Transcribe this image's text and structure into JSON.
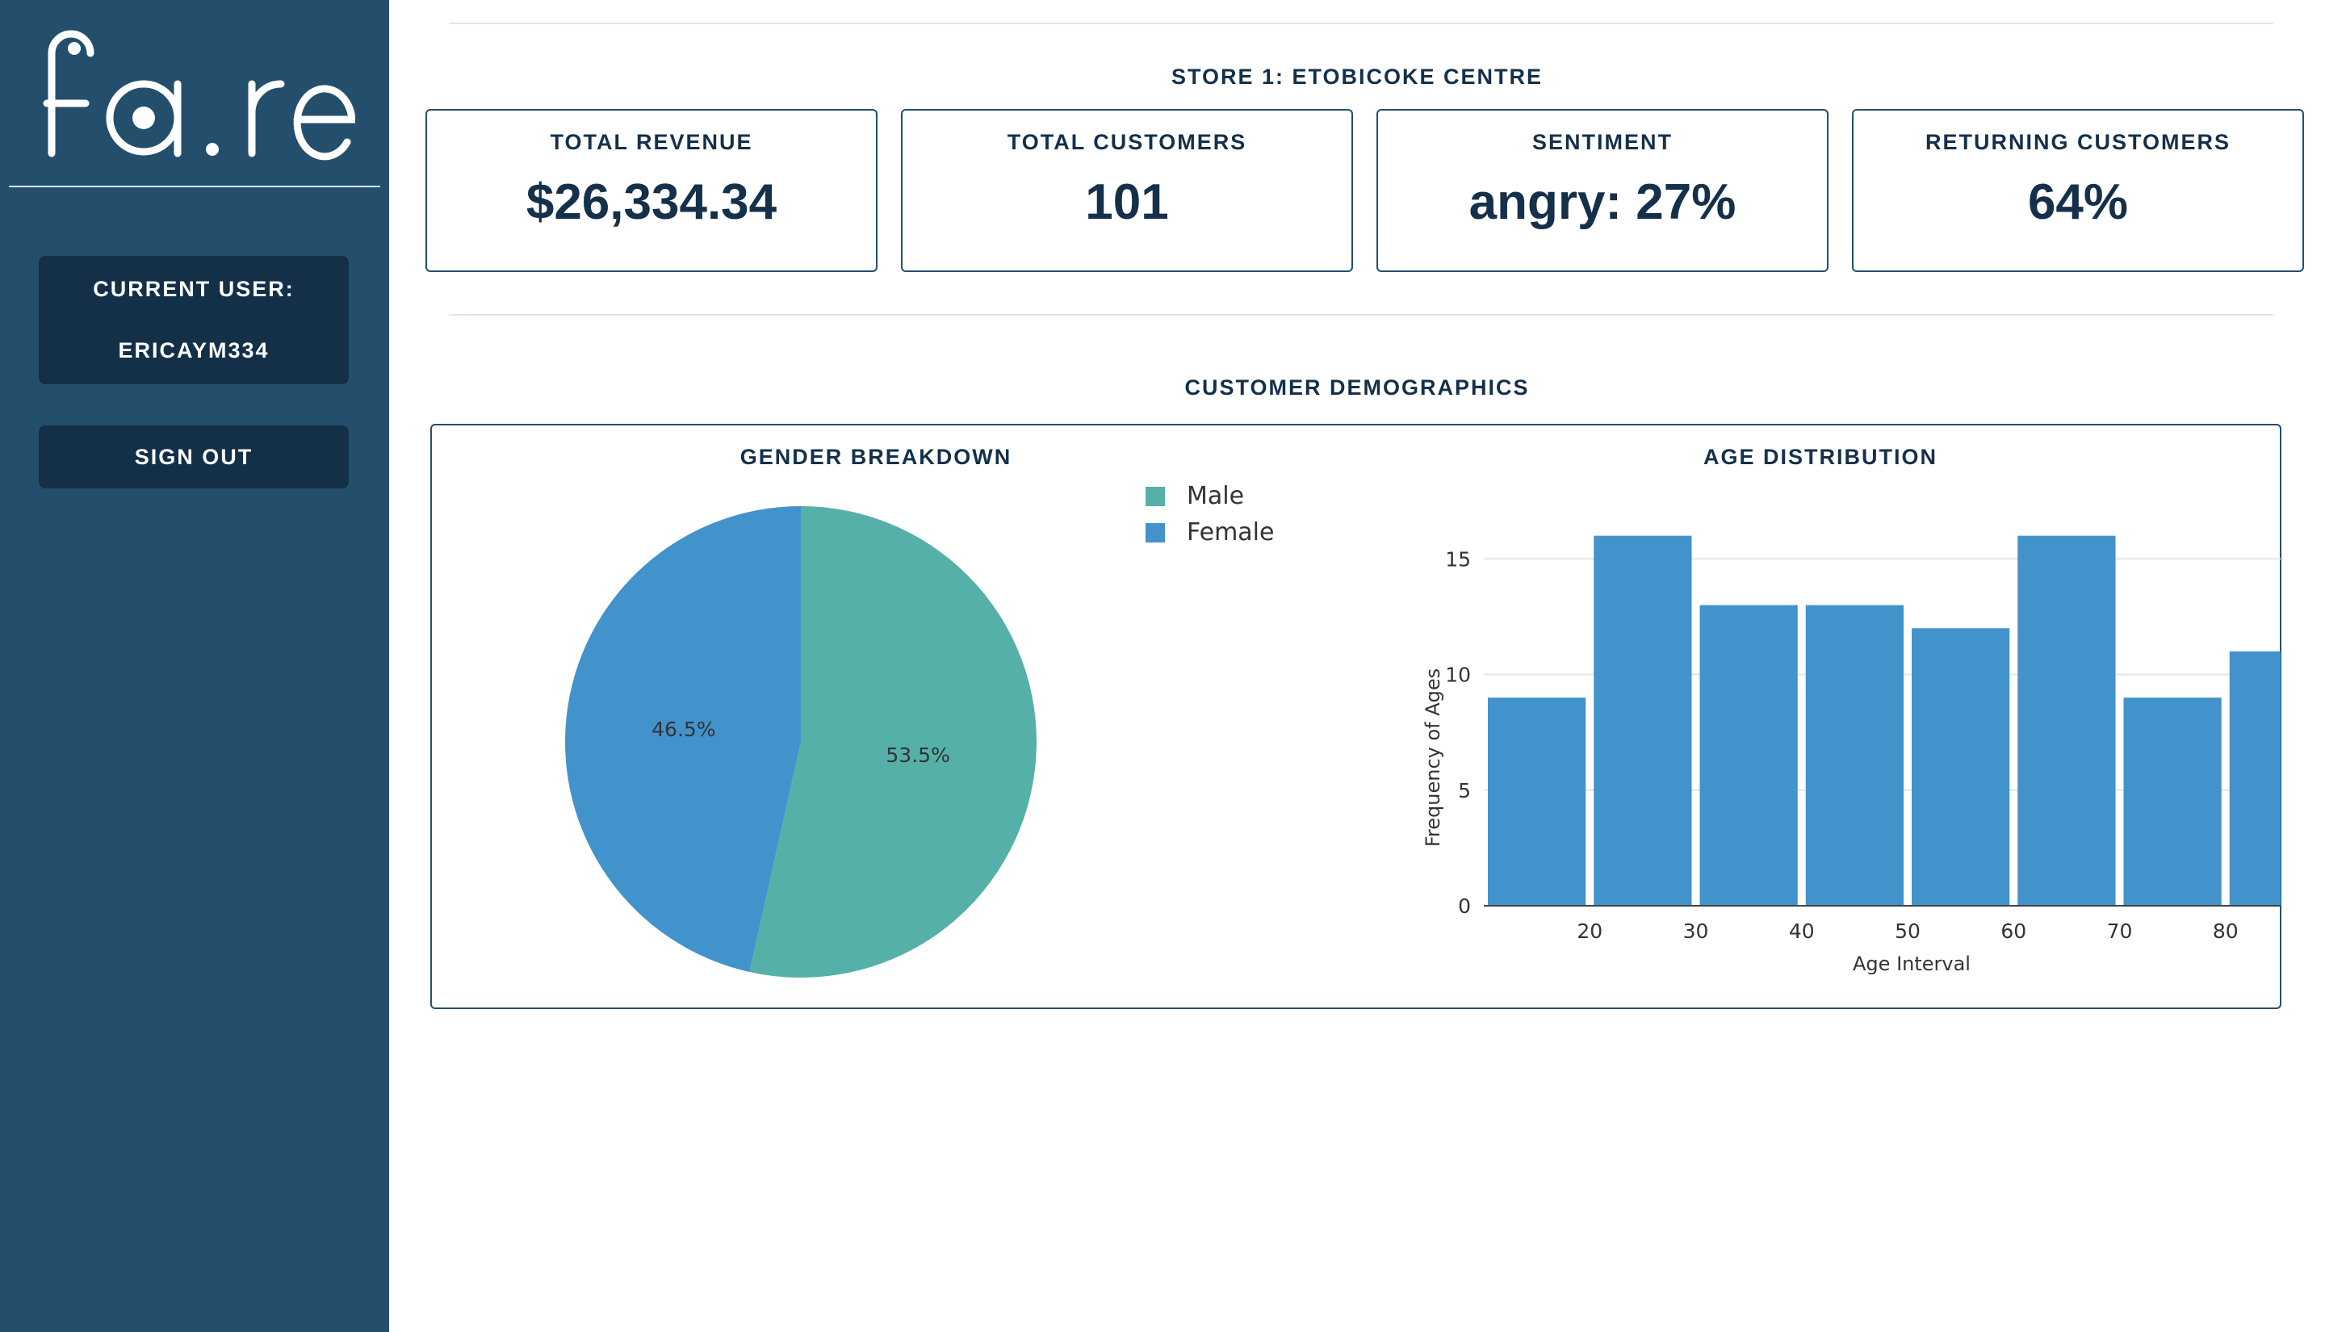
{
  "sidebar": {
    "logo_text": "fa.re",
    "current_user_label": "CURRENT USER:",
    "current_user_name": "ERICAYM334",
    "sign_out_label": "SIGN OUT"
  },
  "store": {
    "title": "STORE 1: ETOBICOKE CENTRE"
  },
  "kpis": [
    {
      "label": "TOTAL REVENUE",
      "value": "$26,334.34"
    },
    {
      "label": "TOTAL CUSTOMERS",
      "value": "101"
    },
    {
      "label": "SENTIMENT",
      "value": "angry: 27%"
    },
    {
      "label": "RETURNING CUSTOMERS",
      "value": "64%"
    }
  ],
  "demographics": {
    "title": "CUSTOMER DEMOGRAPHICS"
  },
  "colors": {
    "sidebar": "#234f6d",
    "dark": "#133048",
    "male": "#55b0a8",
    "female": "#4293cc",
    "bar": "#4293cc"
  },
  "chart_data": [
    {
      "type": "pie",
      "title": "GENDER BREAKDOWN",
      "labels": [
        "Male",
        "Female"
      ],
      "values": [
        53.5,
        46.5
      ],
      "value_labels": [
        "53.5%",
        "46.5%"
      ],
      "legend": "top-right"
    },
    {
      "type": "bar",
      "title": "AGE DISTRIBUTION",
      "xlabel": "Age Interval",
      "ylabel": "Frequency of Ages",
      "x_ticks": [
        "20",
        "30",
        "40",
        "50",
        "60",
        "70",
        "80"
      ],
      "y_ticks": [
        "0",
        "5",
        "10",
        "15"
      ],
      "bin_edges": [
        10,
        20,
        30,
        40,
        50,
        60,
        70,
        80,
        90
      ],
      "values": [
        9,
        16,
        13,
        13,
        12,
        16,
        9,
        11
      ],
      "xlim": [
        10,
        90
      ],
      "ylim": [
        0,
        17
      ],
      "grid": true
    }
  ]
}
